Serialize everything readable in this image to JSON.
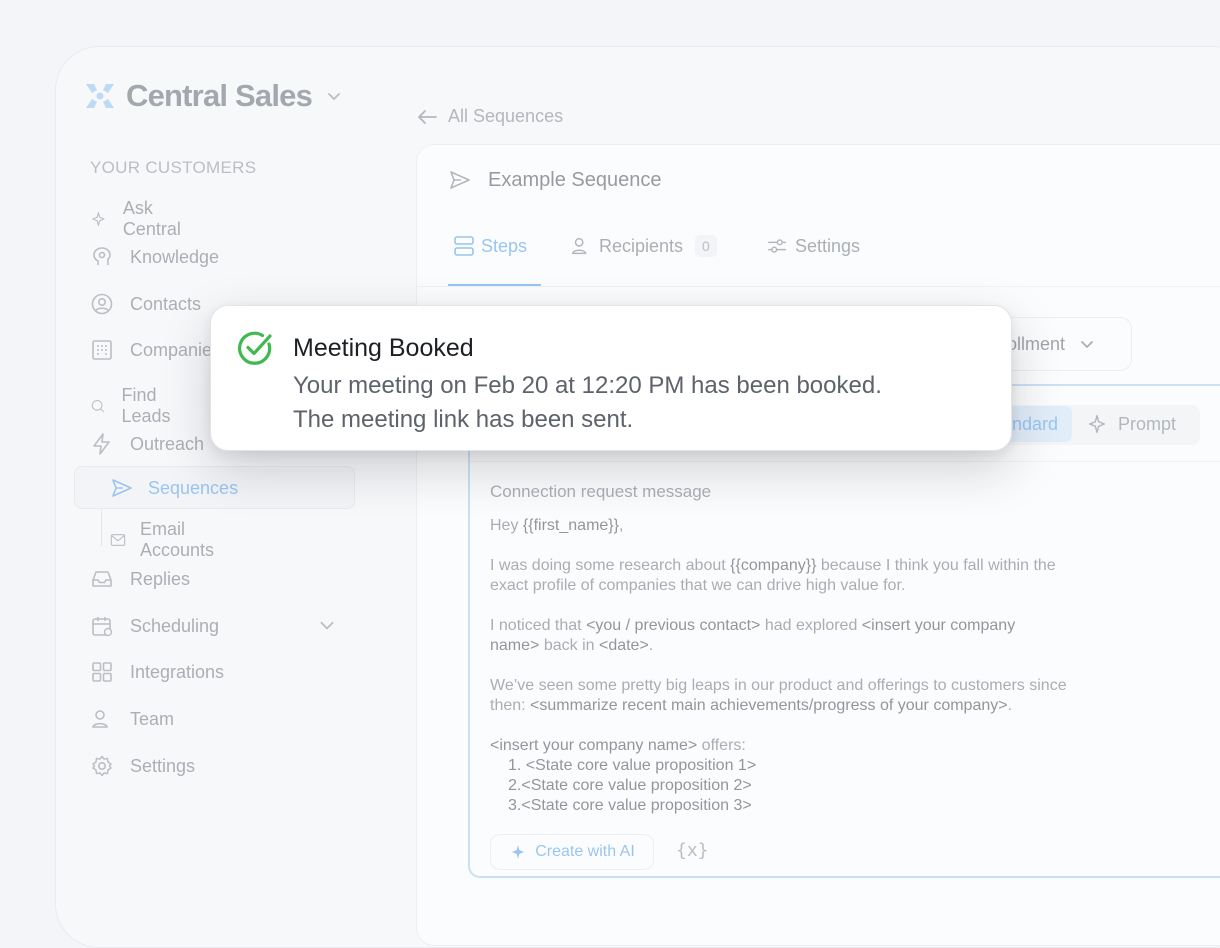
{
  "brand": {
    "name": "Central Sales",
    "icon": "central-logo-icon",
    "accent": "#8fc3f0"
  },
  "sidebar": {
    "section_label": "YOUR CUSTOMERS",
    "items": [
      {
        "label": "Ask Central",
        "icon": "sparkle-icon"
      },
      {
        "label": "Knowledge",
        "icon": "brain-icon"
      },
      {
        "label": "Contacts",
        "icon": "user-circle-icon"
      },
      {
        "label": "Companies",
        "icon": "building-icon"
      },
      {
        "label": "Find Leads",
        "icon": "search-icon"
      },
      {
        "label": "Outreach",
        "icon": "bolt-icon"
      },
      {
        "label": "Sequences",
        "icon": "send-icon"
      },
      {
        "label": "Email Accounts",
        "icon": "mail-icon"
      },
      {
        "label": "Replies",
        "icon": "inbox-icon"
      },
      {
        "label": "Scheduling",
        "icon": "calendar-icon"
      },
      {
        "label": "Integrations",
        "icon": "grid-icon"
      },
      {
        "label": "Team",
        "icon": "users-icon"
      },
      {
        "label": "Settings",
        "icon": "gear-icon"
      }
    ]
  },
  "header": {
    "back_label": "All Sequences",
    "sequence_title": "Example Sequence"
  },
  "tabs": [
    {
      "label": "Steps",
      "icon": "steps-icon",
      "active": true
    },
    {
      "label": "Recipients",
      "icon": "users-icon",
      "count": "0"
    },
    {
      "label": "Settings",
      "icon": "sliders-icon"
    }
  ],
  "dropdown": {
    "value": "rollment"
  },
  "editor": {
    "mode_standard": "ndard",
    "mode_prompt": "Prompt",
    "message_label": "Connection request message",
    "greeting_prefix": "Hey ",
    "greeting_var": "{{first_name}}",
    "greeting_suffix": ",",
    "p1_a": "I was doing some research about ",
    "p1_var": "{{company}}",
    "p1_b": " because I think you fall within the",
    "p1_line2": "exact profile of companies that we can drive high value for.",
    "p2_a": "I noticed that ",
    "p2_var1": "<you / previous contact>",
    "p2_b": " had explored ",
    "p2_var2": "<insert your company",
    "p2_var2b": "name>",
    "p2_c": " back in ",
    "p2_var3": "<date>",
    "p2_d": ".",
    "p3_line1": "We’ve seen some pretty big leaps in our product and offerings to customers since",
    "p3_a": "then: ",
    "p3_var": "<summarize recent main achievements/progress of your company>",
    "p3_b": ".",
    "p4_var": "<insert your company name>",
    "p4_b": " offers:",
    "list": [
      "1. <State core value proposition 1>",
      "2.<State core value proposition 2>",
      "3.<State core value proposition 3>"
    ],
    "ai_button": "Create with AI",
    "variable_button": "{x}"
  },
  "toast": {
    "title": "Meeting Booked",
    "line1": "Your meeting on Feb 20 at 12:20 PM has been booked.",
    "line2": "The meeting link has been sent.",
    "icon": "check-circle-icon",
    "icon_color": "#3fb950"
  }
}
